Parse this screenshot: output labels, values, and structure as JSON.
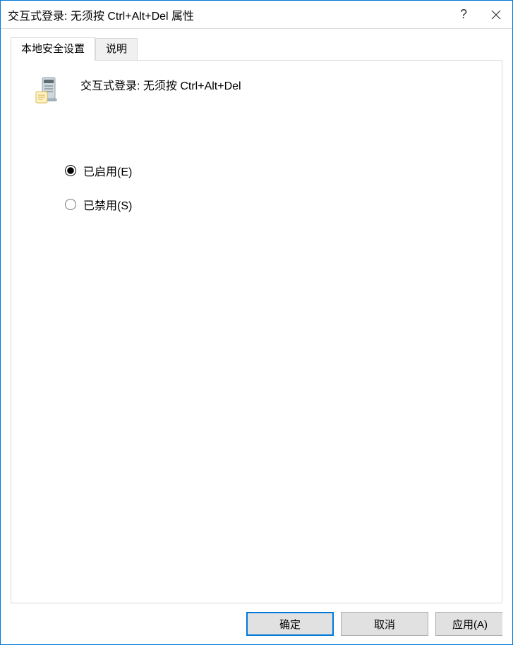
{
  "titlebar": {
    "title": "交互式登录: 无须按 Ctrl+Alt+Del 属性",
    "help": "?",
    "close": "✕"
  },
  "tabs": {
    "security": "本地安全设置",
    "explain": "说明"
  },
  "policy": {
    "name": "交互式登录: 无须按 Ctrl+Alt+Del"
  },
  "radios": {
    "enabled": "已启用(E)",
    "disabled": "已禁用(S)",
    "selected": "enabled"
  },
  "buttons": {
    "ok": "确定",
    "cancel": "取消",
    "apply": "应用(A)"
  },
  "icons": {
    "policy": "server-policy-icon",
    "help": "help-icon",
    "close": "close-icon"
  }
}
